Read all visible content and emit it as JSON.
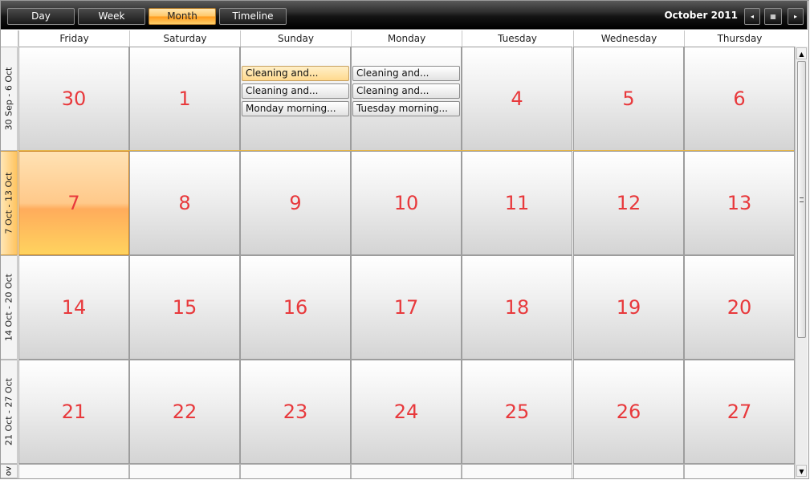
{
  "toolbar": {
    "views": [
      "Day",
      "Week",
      "Month",
      "Timeline"
    ],
    "active_view": "Month",
    "period_title": "October 2011",
    "prev_icon": "◂",
    "calendar_icon": "▦",
    "next_icon": "▸"
  },
  "day_headers": [
    "Friday",
    "Saturday",
    "Sunday",
    "Monday",
    "Tuesday",
    "Wednesday",
    "Thursday"
  ],
  "weeks": [
    {
      "label": "30 Sep - 6 Oct",
      "days": [
        {
          "num": "30",
          "appointments": []
        },
        {
          "num": "1",
          "appointments": []
        },
        {
          "num": "",
          "appointments": [
            "Cleaning and...",
            "Cleaning and...",
            "Monday morning..."
          ]
        },
        {
          "num": "",
          "appointments": [
            "Cleaning and...",
            "Cleaning and...",
            "Tuesday morning..."
          ]
        },
        {
          "num": "4",
          "appointments": []
        },
        {
          "num": "5",
          "appointments": []
        },
        {
          "num": "6",
          "appointments": []
        }
      ]
    },
    {
      "label": "7 Oct - 13 Oct",
      "days": [
        {
          "num": "7",
          "appointments": []
        },
        {
          "num": "8",
          "appointments": []
        },
        {
          "num": "9",
          "appointments": []
        },
        {
          "num": "10",
          "appointments": []
        },
        {
          "num": "11",
          "appointments": []
        },
        {
          "num": "12",
          "appointments": []
        },
        {
          "num": "13",
          "appointments": []
        }
      ]
    },
    {
      "label": "14 Oct - 20 Oct",
      "days": [
        {
          "num": "14",
          "appointments": []
        },
        {
          "num": "15",
          "appointments": []
        },
        {
          "num": "16",
          "appointments": []
        },
        {
          "num": "17",
          "appointments": []
        },
        {
          "num": "18",
          "appointments": []
        },
        {
          "num": "19",
          "appointments": []
        },
        {
          "num": "20",
          "appointments": []
        }
      ]
    },
    {
      "label": "21 Oct - 27 Oct",
      "days": [
        {
          "num": "21",
          "appointments": []
        },
        {
          "num": "22",
          "appointments": []
        },
        {
          "num": "23",
          "appointments": []
        },
        {
          "num": "24",
          "appointments": []
        },
        {
          "num": "25",
          "appointments": []
        },
        {
          "num": "26",
          "appointments": []
        },
        {
          "num": "27",
          "appointments": []
        }
      ]
    }
  ],
  "partial_week_label": "ov",
  "highlighted_appointment": "Cleaning and...",
  "selected_day": "7",
  "scrollbar": {
    "up_icon": "▲",
    "down_icon": "▼"
  }
}
